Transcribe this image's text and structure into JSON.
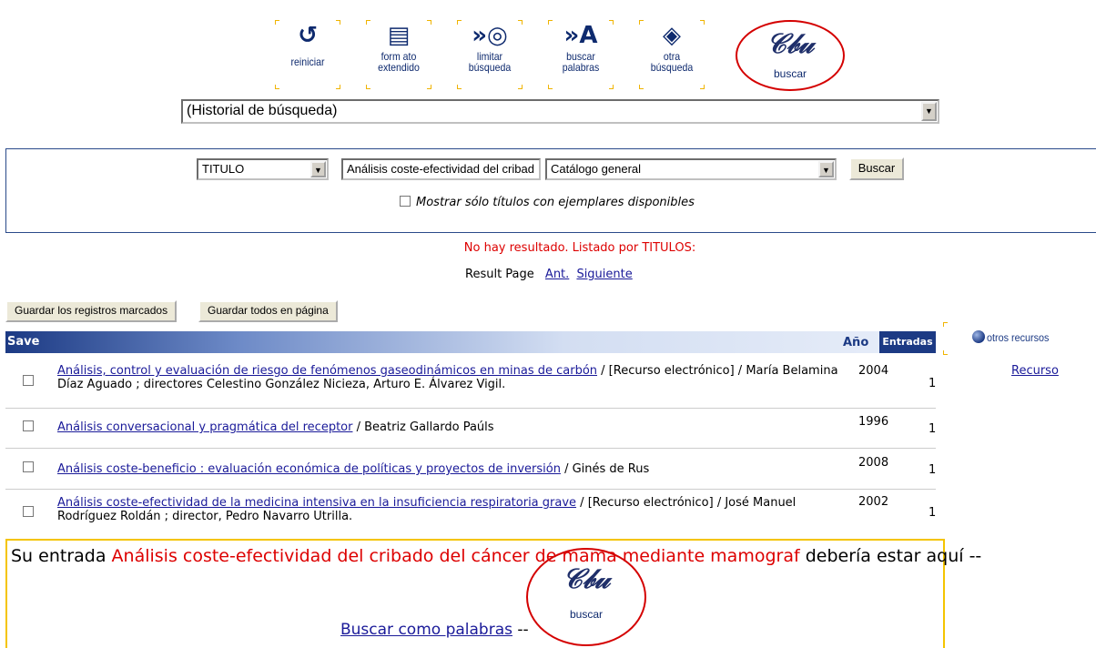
{
  "toolbar": {
    "buttons": [
      {
        "icon": "reiniciar-icon",
        "glyph": "↺",
        "label1": "reiniciar",
        "label2": ""
      },
      {
        "icon": "formato-extendido-icon",
        "glyph": "▤",
        "label1": "form ato",
        "label2": "extendido"
      },
      {
        "icon": "limitar-busqueda-icon",
        "glyph": "»◎",
        "label1": "limitar",
        "label2": "búsqueda"
      },
      {
        "icon": "buscar-palabras-icon",
        "glyph": "»A",
        "label1": "buscar",
        "label2": "palabras"
      },
      {
        "icon": "otra-busqueda-icon",
        "glyph": "◈",
        "label1": "otra",
        "label2": "búsqueda"
      }
    ],
    "logo_label": "buscar"
  },
  "history": {
    "value": "(Historial de búsqueda)"
  },
  "search": {
    "field": "TITULO",
    "query": "Análisis coste-efectividad del cribad",
    "catalog": "Catálogo general",
    "button": "Buscar",
    "available_label": "Mostrar sólo títulos con ejemplares disponibles"
  },
  "messages": {
    "no_result": "No hay resultado. Listado por TITULOS:",
    "result_page": "Result Page",
    "prev": "Ant.",
    "next": "Siguiente"
  },
  "save_buttons": {
    "marked": "Guardar los registros marcados",
    "all": "Guardar todos en página"
  },
  "table": {
    "col_save": "Save",
    "col_year": "Año",
    "col_entries": "Entradas",
    "rows": [
      {
        "title": "Análisis, control y evaluación de riesgo de fenómenos gaseodinámicos en minas de carbón",
        "rest": " / [Recurso electrónico] / María Belamina Díaz Aguado ; directores Celestino González Nicieza, Arturo E. Álvarez Vigil.",
        "year": "2004",
        "entries": "1"
      },
      {
        "title": "Análisis conversacional y pragmática del receptor",
        "rest": " / Beatriz Gallardo Paúls",
        "year": "1996",
        "entries": "1"
      },
      {
        "title": "Análisis coste-beneficio : evaluación económica de políticas y proyectos de inversión",
        "rest": " / Ginés de Rus",
        "year": "2008",
        "entries": "1"
      },
      {
        "title": "Análisis coste-efectividad de la medicina intensiva en la insuficiencia respiratoria grave",
        "rest": " / [Recurso electrónico] / José Manuel Rodríguez Roldán ; director, Pedro Navarro Utrilla.",
        "year": "2002",
        "entries": "1"
      }
    ]
  },
  "side": {
    "other_resources": "otros recursos",
    "recurso": "Recurso"
  },
  "entry": {
    "prefix": "Su entrada ",
    "term": "Análisis coste-efectividad del cribado del cáncer de mama mediante mamograf",
    "suffix": " debería estar aquí --",
    "buscar_palabras": "Buscar como palabras",
    "dashes": " --",
    "logo_label": "buscar"
  },
  "colors": {
    "accent": "#1c3a84",
    "alert": "#dd0000",
    "highlight_border": "#f4c400"
  }
}
